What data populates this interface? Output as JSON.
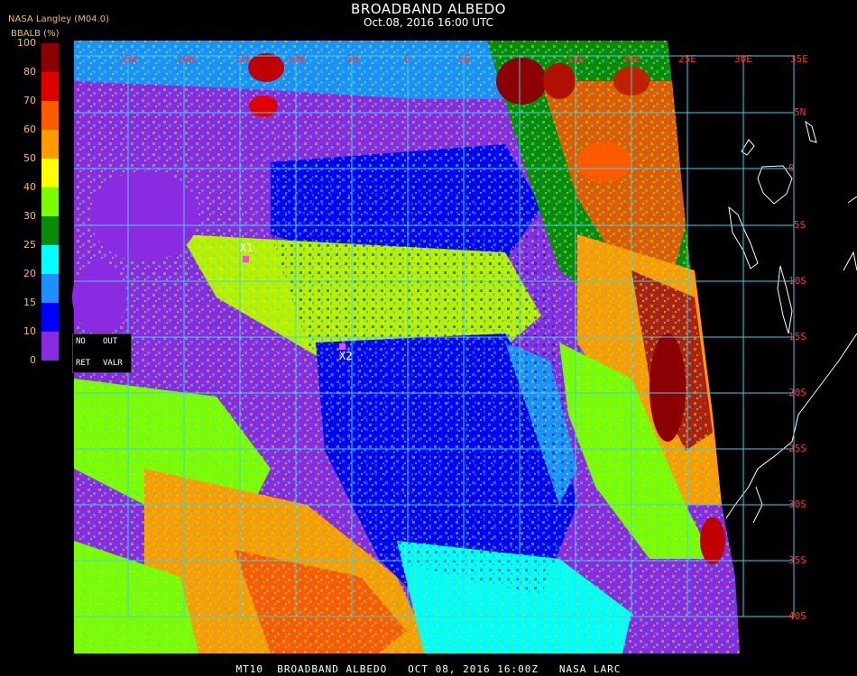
{
  "header": {
    "title": "BROADBAND ALBEDO",
    "subtitle": "Oct.08, 2016 16:00 UTC",
    "agency": "NASA Langley (M04.0)",
    "product_unit": "BBALB (%)"
  },
  "colorbar": {
    "ticks": [
      "100",
      "80",
      "70",
      "60",
      "50",
      "40",
      "30",
      "25",
      "20",
      "15",
      "10",
      "0"
    ],
    "colors": [
      "#5a0000",
      "#8b0000",
      "#e00000",
      "#ff5a00",
      "#ff9a00",
      "#ffff00",
      "#7cfc00",
      "#0a8a0a",
      "#00ffff",
      "#1e8fff",
      "#0000ff",
      "#8a2be2"
    ]
  },
  "grid": {
    "lon_labels": [
      "15W",
      "10W",
      "5W",
      "10W",
      "5W",
      "0",
      "5E",
      "15E",
      "20E",
      "25E",
      "30E",
      "35E"
    ],
    "lat_labels": [
      "5N",
      "0",
      "5S",
      "10S",
      "15S",
      "20S",
      "25S",
      "30S",
      "35S",
      "40S"
    ],
    "line_color": "#3fd0e8",
    "label_color": "#ff3030"
  },
  "legend": {
    "no": "NO",
    "out": "OUT",
    "ret": "RET",
    "valr": "VALR"
  },
  "markers": [
    {
      "label": "X1"
    },
    {
      "label": "X2"
    }
  ],
  "footer": "MT10  BROADBAND ALBEDO   OCT 08, 2016 16:00Z   NASA LARC"
}
